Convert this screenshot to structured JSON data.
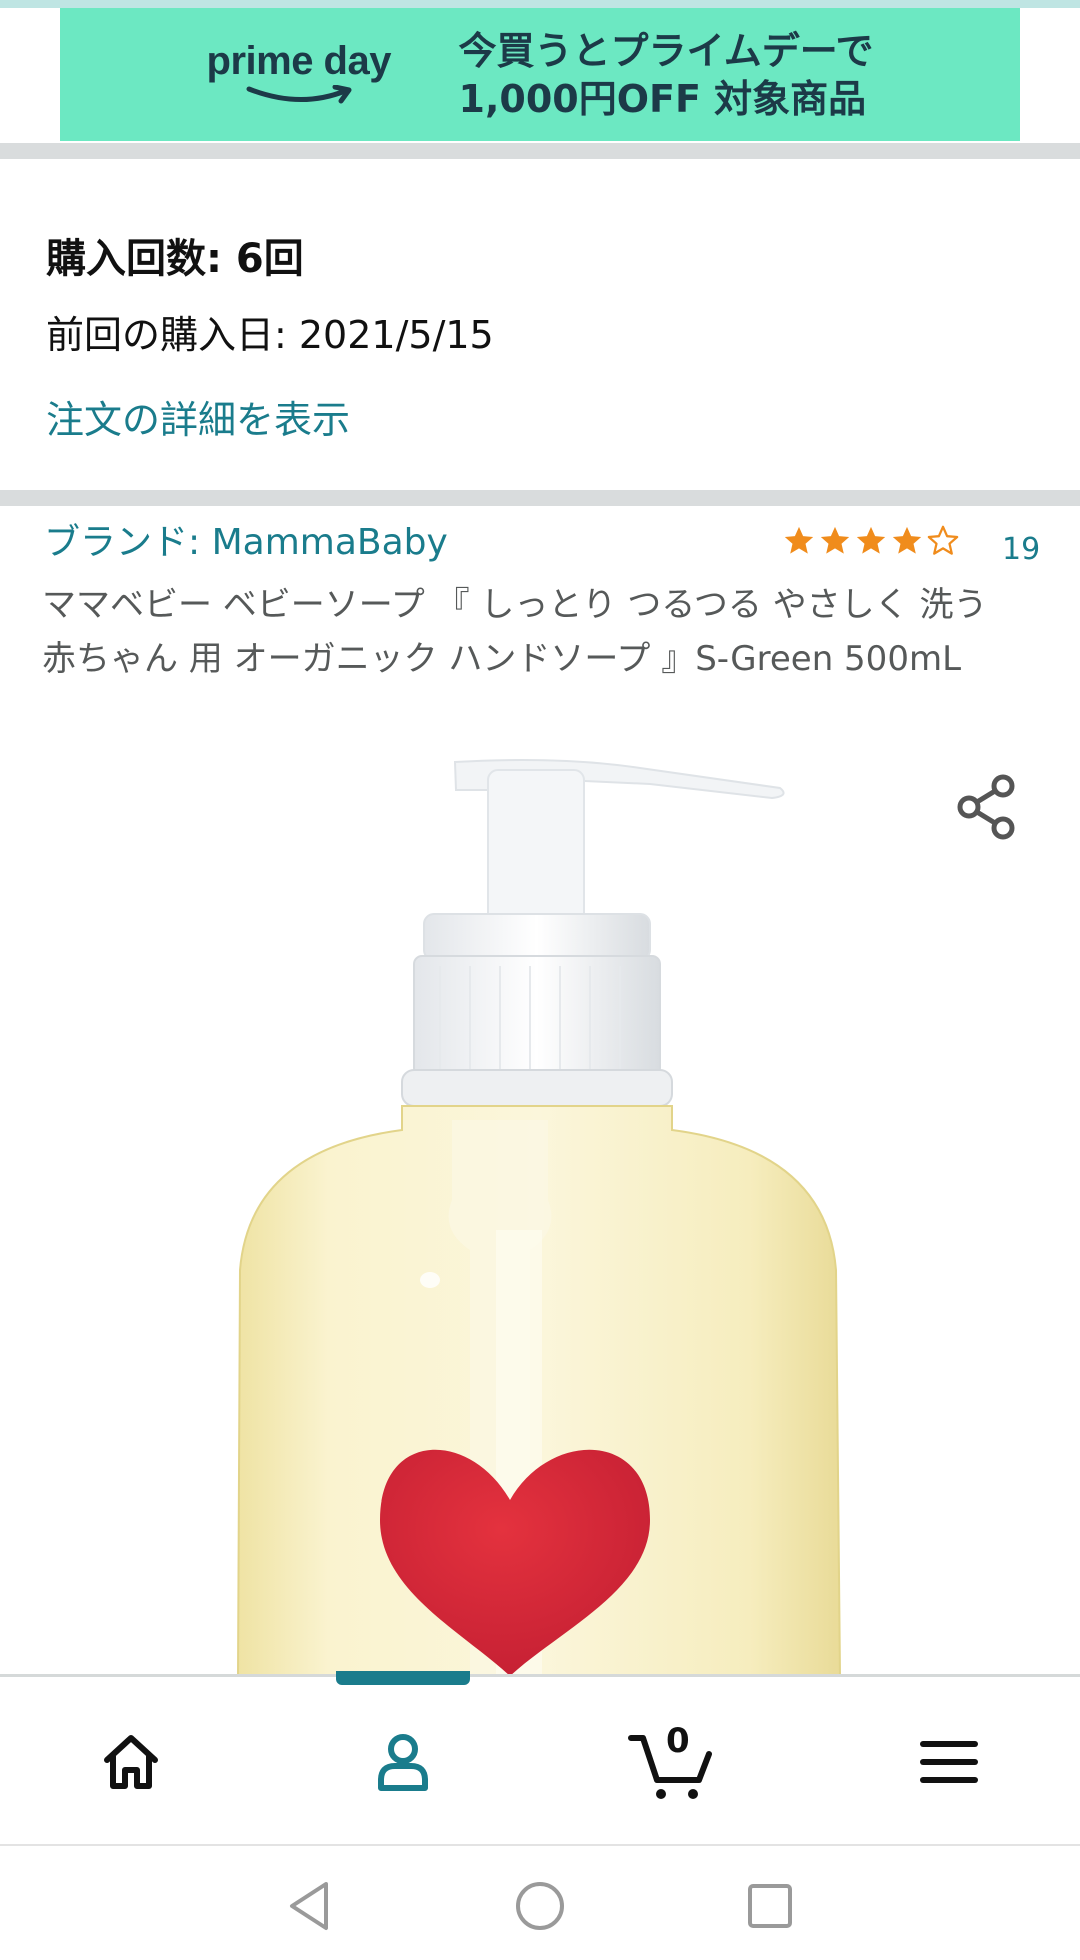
{
  "banner": {
    "logo_text": "prime day",
    "line1": "今買うとプライムデーで",
    "line2": "1,000円OFF 対象商品",
    "background": "#6ce8c2"
  },
  "purchase": {
    "count": "購入回数: 6回",
    "last_date": "前回の購入日: 2021/5/15",
    "details_link": "注文の詳細を表示"
  },
  "product": {
    "brand": "ブランド: MammaBaby",
    "rating": 4.5,
    "review_count": "19",
    "title": "ママベビー ベビーソープ 『 しっとり つるつる やさしく 洗う 赤ちゃん 用 オーガニック ハンドソープ 』S-Green 500mL",
    "image_icon": "soap-pump-bottle-with-heart",
    "share_icon": "share-icon"
  },
  "bottom_nav": {
    "items": [
      {
        "icon": "home-icon"
      },
      {
        "icon": "account-icon",
        "active": true
      },
      {
        "icon": "cart-icon",
        "count": "0"
      },
      {
        "icon": "menu-icon"
      }
    ],
    "active_color": "#1a7c8c"
  },
  "system_nav": [
    "back-icon",
    "home-circle-icon",
    "recents-icon"
  ],
  "colors": {
    "link": "#1a7c8c",
    "star": "#f08c1c",
    "divider": "#d9dcdd"
  }
}
